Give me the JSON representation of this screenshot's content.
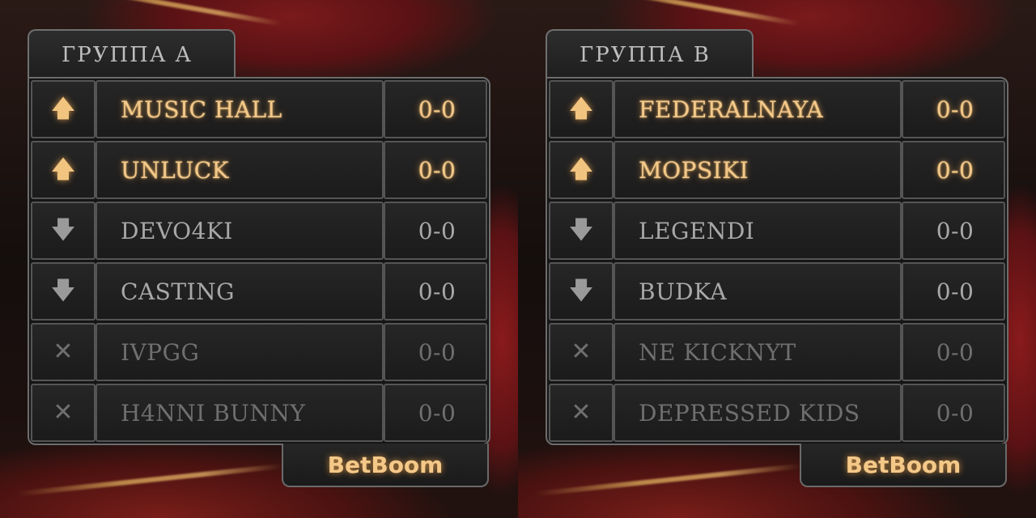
{
  "groups": [
    {
      "title": "ГРУППА A",
      "sponsor": "BetBoom",
      "teams": [
        {
          "status": "up",
          "icon": "arrow-up-icon",
          "glyph": "🡅",
          "name": "MUSIC HALL",
          "score": "0-0"
        },
        {
          "status": "up",
          "icon": "arrow-up-icon",
          "glyph": "🡅",
          "name": "UNLUCK",
          "score": "0-0"
        },
        {
          "status": "down",
          "icon": "arrow-down-icon",
          "glyph": "🡇",
          "name": "DEVO4KI",
          "score": "0-0"
        },
        {
          "status": "down",
          "icon": "arrow-down-icon",
          "glyph": "🡇",
          "name": "CASTING",
          "score": "0-0"
        },
        {
          "status": "out",
          "icon": "cross-icon",
          "glyph": "✕",
          "name": "IVPGG",
          "score": "0-0"
        },
        {
          "status": "out",
          "icon": "cross-icon",
          "glyph": "✕",
          "name": "H4NNI BUNNY",
          "score": "0-0"
        }
      ]
    },
    {
      "title": "ГРУППА B",
      "sponsor": "BetBoom",
      "teams": [
        {
          "status": "up",
          "icon": "arrow-up-icon",
          "glyph": "🡅",
          "name": "FEDERALNAYA",
          "score": "0-0"
        },
        {
          "status": "up",
          "icon": "arrow-up-icon",
          "glyph": "🡅",
          "name": "MOPSIKI",
          "score": "0-0"
        },
        {
          "status": "down",
          "icon": "arrow-down-icon",
          "glyph": "🡇",
          "name": "LEGENDI",
          "score": "0-0"
        },
        {
          "status": "down",
          "icon": "arrow-down-icon",
          "glyph": "🡇",
          "name": "BUDKA",
          "score": "0-0"
        },
        {
          "status": "out",
          "icon": "cross-icon",
          "glyph": "✕",
          "name": "NE KICKNYT",
          "score": "0-0"
        },
        {
          "status": "out",
          "icon": "cross-icon",
          "glyph": "✕",
          "name": "DEPRESSED KIDS",
          "score": "0-0"
        }
      ]
    }
  ],
  "colors": {
    "advancing": "#f3c98a",
    "lower": "#a8a8a8",
    "eliminated": "#6f6f6f",
    "border": "#6c6c6c",
    "backdrop_red": "#7a1a1c"
  }
}
